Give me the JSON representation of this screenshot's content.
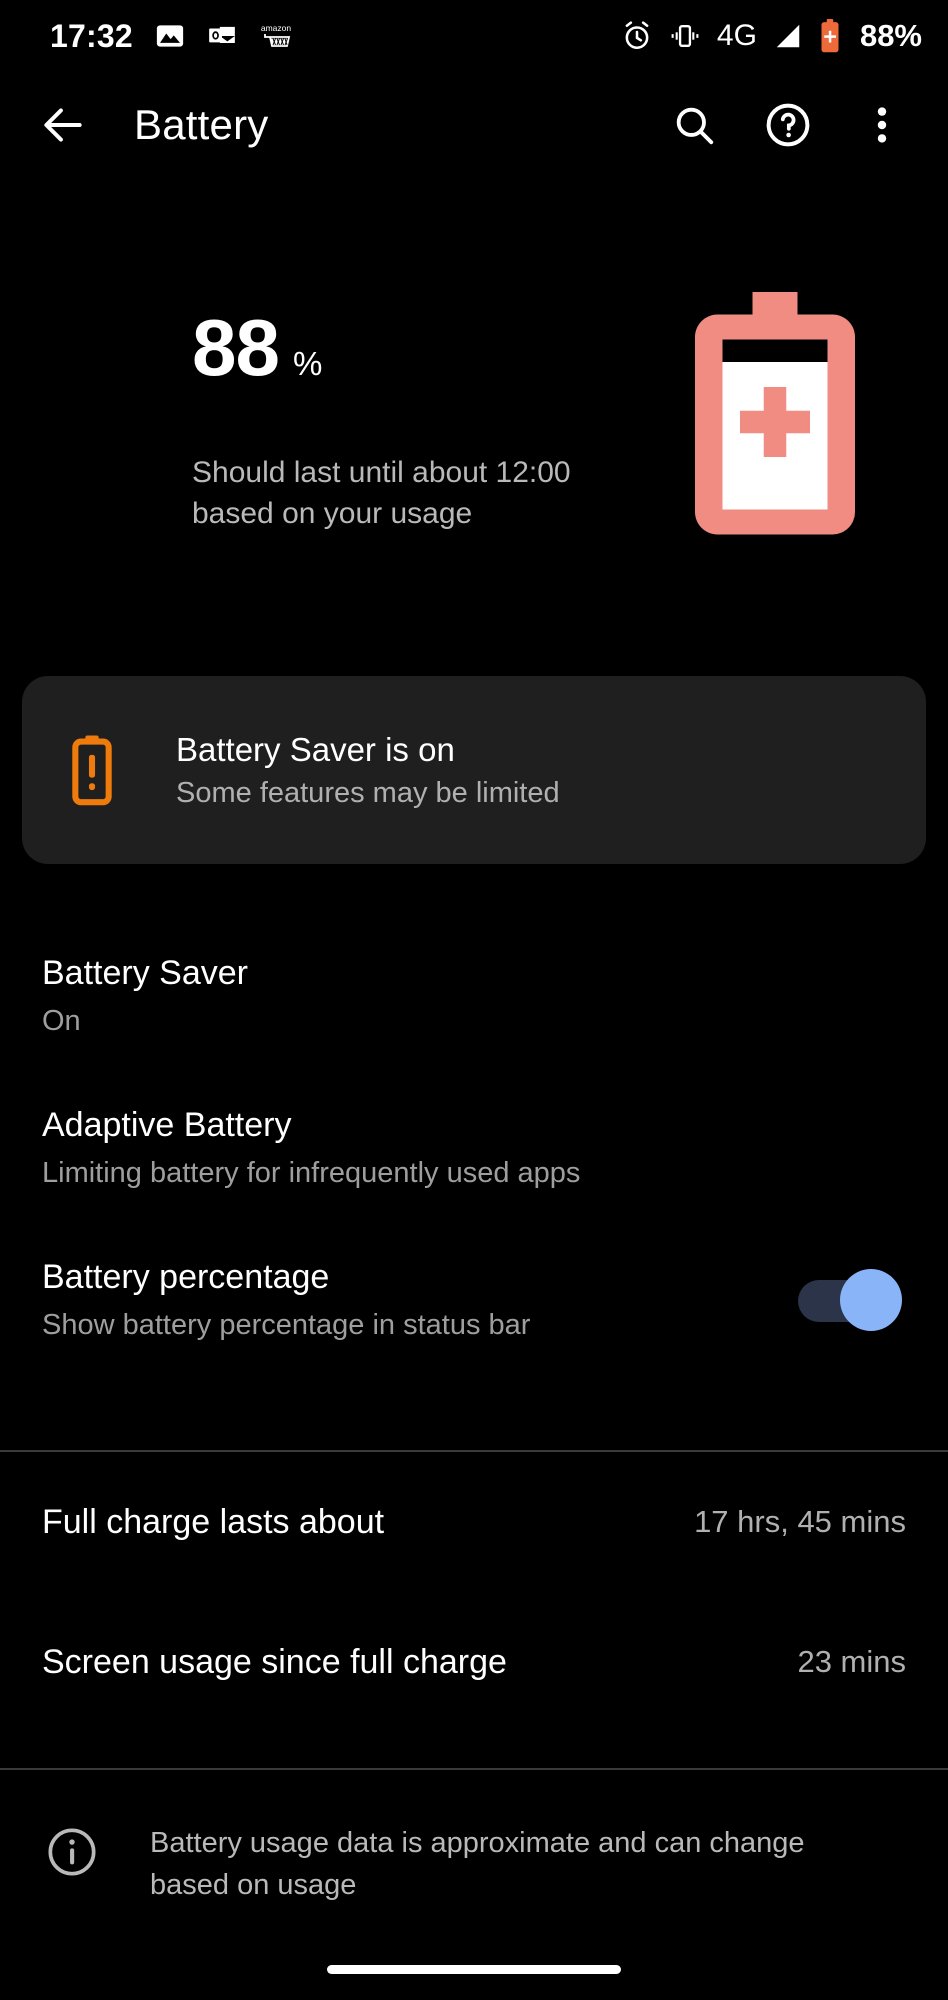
{
  "status_bar": {
    "clock": "17:32",
    "left_icons": [
      "photos-icon",
      "outlook-icon",
      "amazon-icon"
    ],
    "right_icons": [
      "alarm-icon",
      "vibrate-icon",
      "signal-icon"
    ],
    "network_type": "4G",
    "battery_percent_label": "88%",
    "battery_icon": "battery-saver-icon",
    "battery_icon_color": "#EE6A3A"
  },
  "action_bar": {
    "back_icon": "arrow-back-icon",
    "title": "Battery",
    "search_icon": "search-icon",
    "help_icon": "help-circle-icon",
    "overflow_icon": "more-vert-icon"
  },
  "hero": {
    "level_number": "88",
    "percent_symbol": "%",
    "estimate_text": "Should last until about 12:00 based on your usage",
    "battery_graphic_icon": "battery-plus-icon",
    "battery_graphic_color": "#F08C82",
    "battery_fill_percent": 88
  },
  "banner": {
    "icon": "battery-alert-icon",
    "icon_color": "#EE7B0C",
    "title": "Battery Saver is on",
    "subtitle": "Some features may be limited",
    "background": "#1F1F1F"
  },
  "preferences": [
    {
      "title": "Battery Saver",
      "subtitle": "On",
      "control": "none"
    },
    {
      "title": "Adaptive Battery",
      "subtitle": "Limiting battery for infrequently used apps",
      "control": "none"
    },
    {
      "title": "Battery percentage",
      "subtitle": "Show battery percentage in status bar",
      "control": "switch",
      "switch_on": true,
      "switch_thumb_color": "#8AB4F8",
      "switch_track_color": "#2B3448"
    }
  ],
  "stats": [
    {
      "label": "Full charge lasts about",
      "value": "17 hrs, 45 mins"
    },
    {
      "label": "Screen usage since full charge",
      "value": "23 mins"
    }
  ],
  "footer": {
    "icon": "info-circle-icon",
    "text": "Battery usage data is approximate and can change based on usage"
  },
  "navigation": {
    "home_pill": "home-gesture-pill"
  }
}
